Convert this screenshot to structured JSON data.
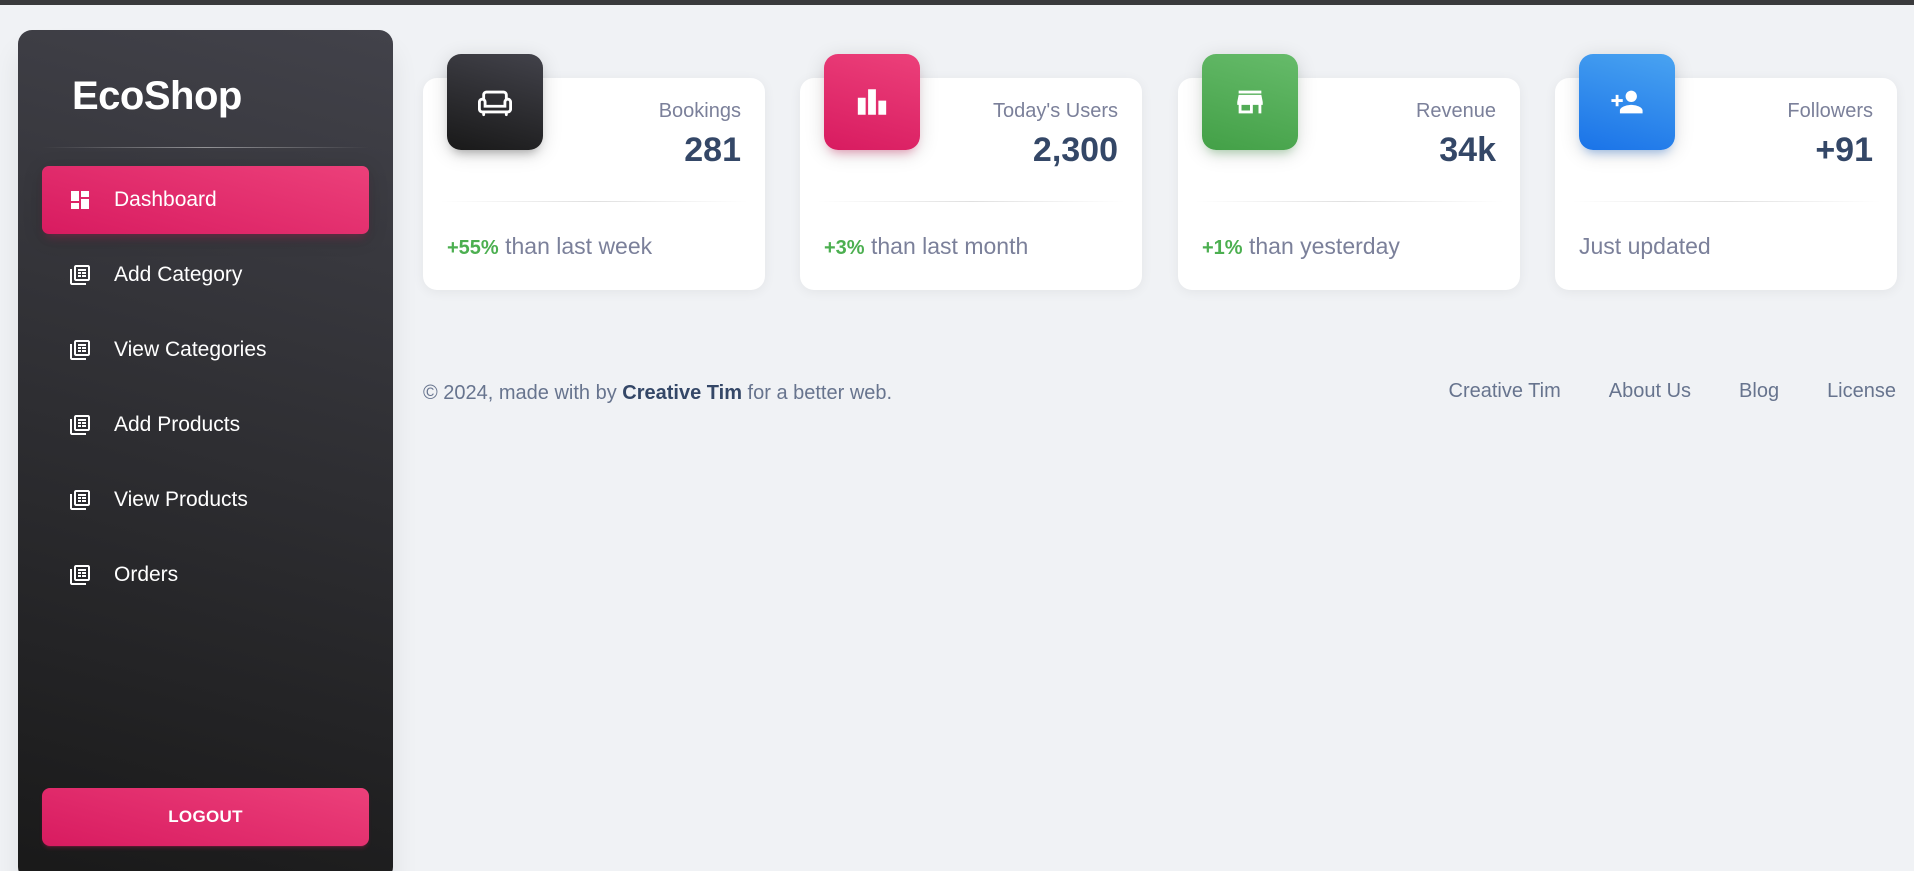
{
  "app": {
    "brand": "EcoShop",
    "accent": "#e91e63",
    "sidebar_bg": "#191919"
  },
  "sidebar": {
    "items": [
      {
        "label": "Dashboard",
        "icon": "dashboard-icon",
        "active": true
      },
      {
        "label": "Add Category",
        "icon": "table-icon",
        "active": false
      },
      {
        "label": "View Categories",
        "icon": "table-icon",
        "active": false
      },
      {
        "label": "Add Products",
        "icon": "table-icon",
        "active": false
      },
      {
        "label": "View Products",
        "icon": "table-icon",
        "active": false
      },
      {
        "label": "Orders",
        "icon": "table-icon",
        "active": false
      }
    ],
    "logout_label": "LOGOUT"
  },
  "cards": [
    {
      "label": "Bookings",
      "value": "281",
      "change": "+55%",
      "change_text": " than last week",
      "icon": "sofa-icon",
      "color": "#191919"
    },
    {
      "label": "Today's Users",
      "value": "2,300",
      "change": "+3%",
      "change_text": " than last month",
      "icon": "leaderboard-icon",
      "color": "#e91e63"
    },
    {
      "label": "Revenue",
      "value": "34k",
      "change": "+1%",
      "change_text": " than yesterday",
      "icon": "store-icon",
      "color": "#43a047"
    },
    {
      "label": "Followers",
      "value": "+91",
      "change": "",
      "change_text": "Just updated",
      "icon": "person-add-icon",
      "color": "#1a73e8"
    }
  ],
  "footer": {
    "copy_prefix": "© 2024, made with by ",
    "copy_author": "Creative Tim",
    "copy_suffix": " for a better web.",
    "links": [
      "Creative Tim",
      "About Us",
      "Blog",
      "License"
    ]
  }
}
